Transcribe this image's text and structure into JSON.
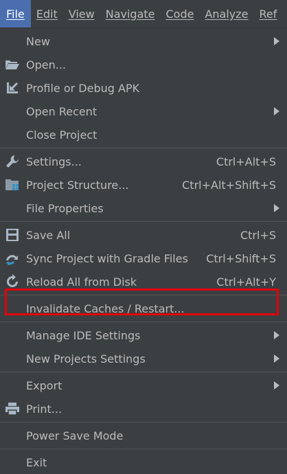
{
  "menubar": {
    "items": [
      {
        "label": "File"
      },
      {
        "label": "Edit"
      },
      {
        "label": "View"
      },
      {
        "label": "Navigate"
      },
      {
        "label": "Code"
      },
      {
        "label": "Analyze"
      },
      {
        "label": "Ref"
      }
    ]
  },
  "file_menu": {
    "new": {
      "label": "New"
    },
    "open": {
      "label": "Open..."
    },
    "profile": {
      "label": "Profile or Debug APK"
    },
    "open_recent": {
      "label": "Open Recent"
    },
    "close_project": {
      "label": "Close Project"
    },
    "settings": {
      "label": "Settings...",
      "shortcut": "Ctrl+Alt+S"
    },
    "project_structure": {
      "label": "Project Structure...",
      "shortcut": "Ctrl+Alt+Shift+S"
    },
    "file_properties": {
      "label": "File Properties"
    },
    "save_all": {
      "label": "Save All",
      "shortcut": "Ctrl+S"
    },
    "sync_gradle": {
      "label": "Sync Project with Gradle Files",
      "shortcut": "Ctrl+Shift+S"
    },
    "reload_disk": {
      "label": "Reload All from Disk",
      "shortcut": "Ctrl+Alt+Y"
    },
    "invalidate": {
      "label": "Invalidate Caches / Restart..."
    },
    "manage_ide": {
      "label": "Manage IDE Settings"
    },
    "new_projects_settings": {
      "label": "New Projects Settings"
    },
    "export": {
      "label": "Export"
    },
    "print": {
      "label": "Print..."
    },
    "power_save": {
      "label": "Power Save Mode"
    },
    "exit": {
      "label": "Exit"
    }
  },
  "colors": {
    "background": "#3c3f41",
    "active_menu": "#4b6eaf",
    "text": "#bbbbbb",
    "highlight_border": "#e3000b"
  },
  "icons": {
    "open": "folder-open-icon",
    "profile": "arrow-down-left-icon",
    "settings": "wrench-icon",
    "project_structure": "project-structure-icon",
    "save_all": "floppy-disk-icon",
    "sync_gradle": "gradle-sync-icon",
    "reload_disk": "reload-icon",
    "print": "printer-icon"
  }
}
